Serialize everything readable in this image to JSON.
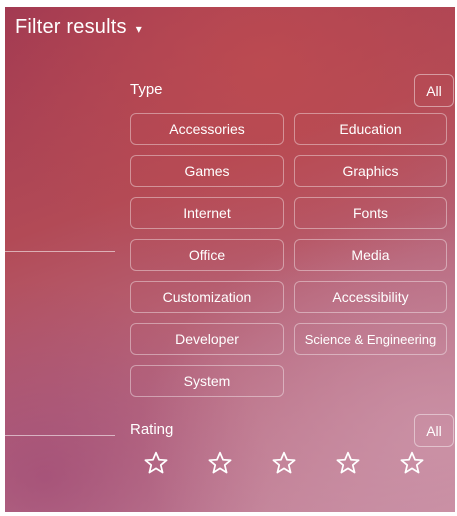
{
  "header": {
    "title": "Filter results",
    "caret": "▾"
  },
  "type_section": {
    "label": "Type",
    "all_label": "All",
    "items": [
      {
        "label": "Accessories"
      },
      {
        "label": "Education"
      },
      {
        "label": "Games"
      },
      {
        "label": "Graphics"
      },
      {
        "label": "Internet"
      },
      {
        "label": "Fonts"
      },
      {
        "label": "Office"
      },
      {
        "label": "Media"
      },
      {
        "label": "Customization"
      },
      {
        "label": "Accessibility"
      },
      {
        "label": "Developer"
      },
      {
        "label": "Science & Engineering"
      },
      {
        "label": "System"
      }
    ]
  },
  "rating_section": {
    "label": "Rating",
    "all_label": "All",
    "stars": [
      {
        "icon": "star-outline-icon"
      },
      {
        "icon": "star-outline-icon"
      },
      {
        "icon": "star-outline-icon"
      },
      {
        "icon": "star-outline-icon"
      },
      {
        "icon": "star-outline-icon"
      }
    ]
  },
  "colors": {
    "text": "#ffffff",
    "background_primary": "#b24a56",
    "background_secondary": "#c68aa0"
  }
}
